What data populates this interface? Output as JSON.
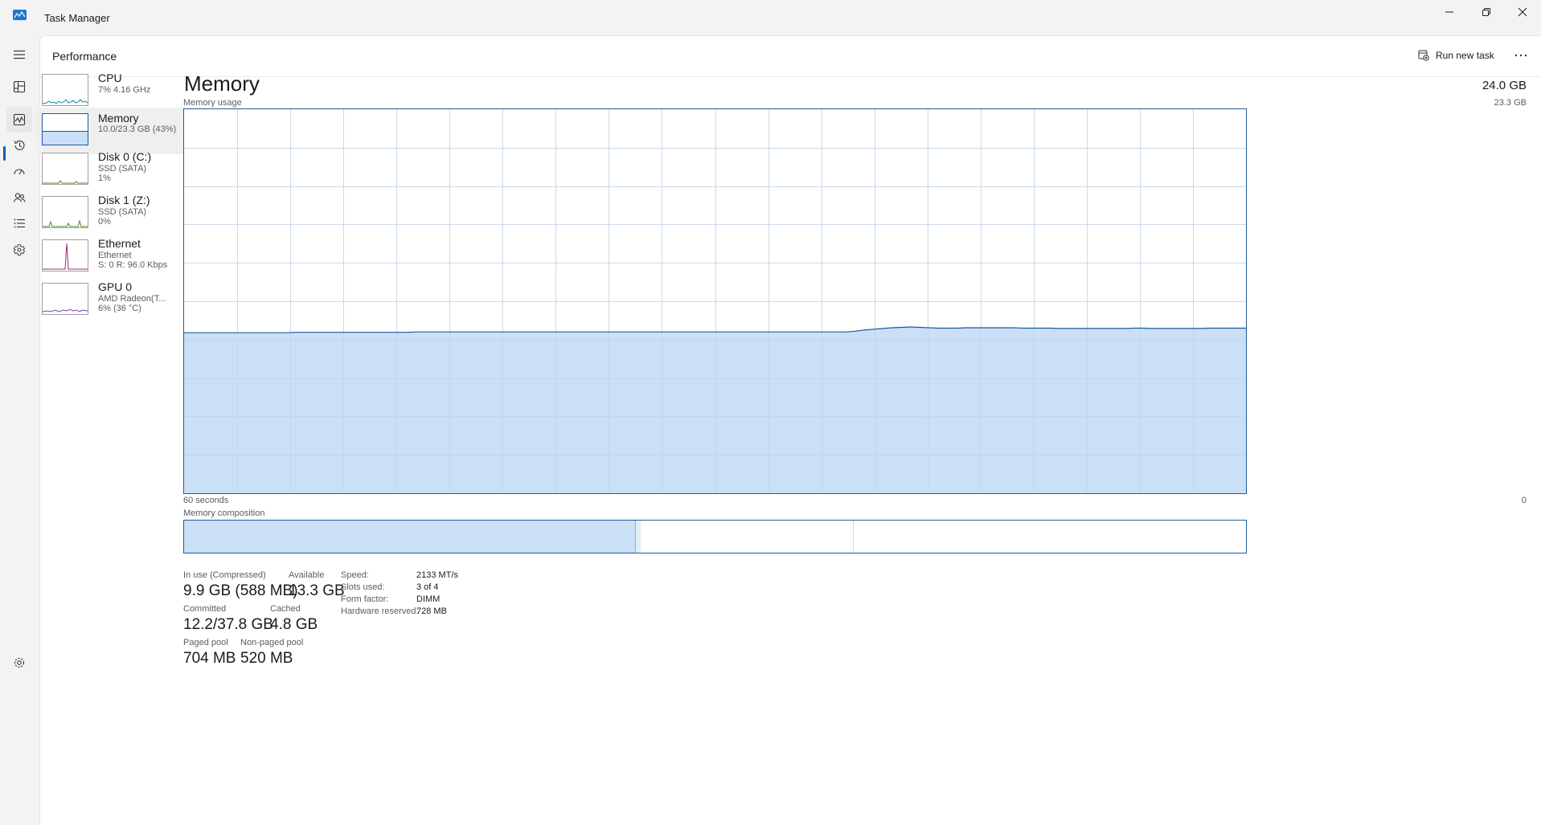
{
  "window": {
    "title": "Task Manager"
  },
  "header": {
    "title": "Performance",
    "run_task_label": "Run new task"
  },
  "nav": [
    {
      "name": "hamburger-icon"
    },
    {
      "name": "processes-icon"
    },
    {
      "name": "performance-icon"
    },
    {
      "name": "app-history-icon"
    },
    {
      "name": "startup-apps-icon"
    },
    {
      "name": "users-icon"
    },
    {
      "name": "details-icon"
    },
    {
      "name": "services-icon"
    },
    {
      "name": "settings-icon"
    }
  ],
  "devices": [
    {
      "name": "CPU",
      "sub1": "7% 4.16 GHz",
      "sub2": ""
    },
    {
      "name": "Memory",
      "sub1": "10.0/23.3 GB (43%)",
      "sub2": ""
    },
    {
      "name": "Disk 0 (C:)",
      "sub1": "SSD (SATA)",
      "sub2": "1%"
    },
    {
      "name": "Disk 1 (Z:)",
      "sub1": "SSD (SATA)",
      "sub2": "0%"
    },
    {
      "name": "Ethernet",
      "sub1": "Ethernet",
      "sub2": "S: 0 R: 96.0 Kbps"
    },
    {
      "name": "GPU 0",
      "sub1": "AMD Radeon(T...",
      "sub2": "6% (36 °C)"
    }
  ],
  "memory": {
    "title": "Memory",
    "total": "24.0 GB",
    "usage_label": "Memory usage",
    "usage_max": "23.3 GB",
    "time_left": "60 seconds",
    "time_right": "0",
    "composition_label": "Memory composition",
    "composition_fractions": {
      "in_use": 0.425,
      "modified": 0.005,
      "standby": 0.2,
      "free": 0.37
    },
    "usage_history_fraction": [
      0.418,
      0.418,
      0.418,
      0.418,
      0.418,
      0.418,
      0.418,
      0.418,
      0.418,
      0.418,
      0.418,
      0.418,
      0.419,
      0.419,
      0.419,
      0.419,
      0.419,
      0.419,
      0.419,
      0.419,
      0.419,
      0.419,
      0.419,
      0.419,
      0.419,
      0.42,
      0.42,
      0.42,
      0.42,
      0.42,
      0.42,
      0.42,
      0.42,
      0.42,
      0.42,
      0.42,
      0.42,
      0.42,
      0.42,
      0.42,
      0.42,
      0.42,
      0.42,
      0.42,
      0.42,
      0.42,
      0.42,
      0.42,
      0.42,
      0.42,
      0.42,
      0.42,
      0.42,
      0.42,
      0.42,
      0.42,
      0.42,
      0.42,
      0.42,
      0.42,
      0.42,
      0.42,
      0.42,
      0.42,
      0.42,
      0.42,
      0.42,
      0.42,
      0.42,
      0.42,
      0.42,
      0.42,
      0.422,
      0.425,
      0.427,
      0.429,
      0.431,
      0.432,
      0.433,
      0.432,
      0.431,
      0.43,
      0.43,
      0.43,
      0.431,
      0.431,
      0.431,
      0.431,
      0.431,
      0.431,
      0.43,
      0.43,
      0.43,
      0.43,
      0.429,
      0.429,
      0.429,
      0.429,
      0.429,
      0.429,
      0.429,
      0.429,
      0.43,
      0.43,
      0.429,
      0.429,
      0.429,
      0.429,
      0.429,
      0.429,
      0.43,
      0.43,
      0.43,
      0.43,
      0.43
    ],
    "stats": [
      {
        "label": "In use (Compressed)",
        "value": "9.9 GB (588 MB)"
      },
      {
        "label": "Available",
        "value": "13.3 GB"
      },
      {
        "label": "Committed",
        "value": "12.2/37.8 GB"
      },
      {
        "label": "Cached",
        "value": "4.8 GB"
      },
      {
        "label": "Paged pool",
        "value": "704 MB"
      },
      {
        "label": "Non-paged pool",
        "value": "520 MB"
      }
    ],
    "details": [
      {
        "label": "Speed:",
        "value": "2133 MT/s"
      },
      {
        "label": "Slots used:",
        "value": "3 of 4"
      },
      {
        "label": "Form factor:",
        "value": "DIMM"
      },
      {
        "label": "Hardware reserved:",
        "value": "728 MB"
      }
    ]
  },
  "colors": {
    "accent": "#005fb8",
    "mem_fill": "#c9e0f7",
    "mem_line": "#1f5c96",
    "grid": "#e6e6e6",
    "cpu_line": "#0f8aa8",
    "disk_line": "#4d8a2a",
    "eth_line": "#a3286f",
    "gpu_line": "#7b3fbf"
  }
}
